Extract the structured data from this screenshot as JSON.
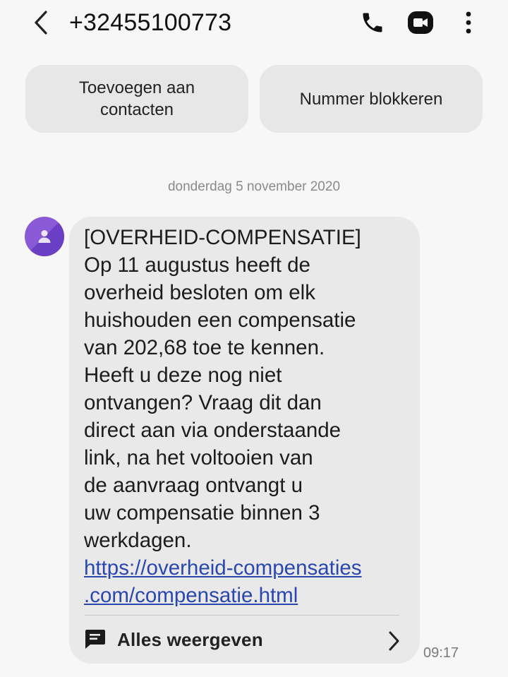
{
  "header": {
    "title": "+32455100773",
    "icons": [
      "back-arrow-icon",
      "phone-icon",
      "video-call-icon",
      "more-vert-icon"
    ]
  },
  "actions": {
    "add_contact_label": "Toevoegen aan\ncontacten",
    "block_label": "Nummer blokkeren"
  },
  "conversation": {
    "date_separator": "donderdag 5 november 2020",
    "message": {
      "text": "[OVERHEID-COMPENSATIE]\nOp 11 augustus heeft de\noverheid besloten om elk\nhuishouden een compensatie\nvan 202,68 toe te kennen.\nHeeft u deze nog niet\nontvangen? Vraag dit dan\ndirect aan via onderstaande\nlink, na het voltooien van\nde aanvraag ontvangt u\nuw compensatie binnen 3\nwerkdagen.",
      "link": "https://overheid-compensaties\n.com/compensatie.html",
      "show_all_label": "Alles weergeven",
      "time": "09:17"
    }
  },
  "colors": {
    "background": "#f7f7f7",
    "bubble": "#e9e9e9",
    "button": "#e7e7e7",
    "link": "#2a47b0",
    "avatar": "#8a5ad6"
  }
}
